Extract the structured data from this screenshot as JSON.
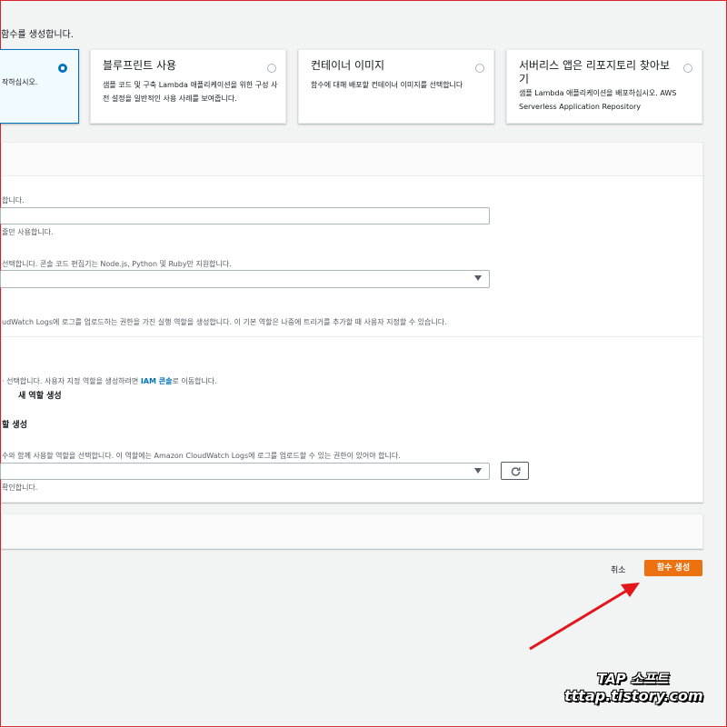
{
  "intro_text": "함수를 생성합니다.",
  "options": [
    {
      "title": "",
      "description": "작하십시오.",
      "selected": true
    },
    {
      "title": "블루프린트 사용",
      "description": "샘플 코드 및 구축 Lambda 애플리케이션을 위한 구성 사전 설정을 일반적인 사용 사례를 보여줍니다.",
      "selected": false
    },
    {
      "title": "컨테이너 이미지",
      "description": "함수에 대해 배포할 컨테이너 이미지를 선택합니다",
      "selected": false
    },
    {
      "title": "서버리스 앱은 리포지토리 찾아보기",
      "description": "샘플 Lambda 애플리케이션을 배포하십시오. AWS Serverless Application Repository",
      "selected": false
    }
  ],
  "basic_info": {
    "name_hint": "합니다.",
    "name_value": "",
    "name_constraint": "줄만 사용합니다.",
    "runtime_hint": "선택합니다. 콘솔 코드 편집기는 Node.js, Python 및 Ruby만 지원합니다.",
    "runtime_value": "",
    "permissions_text": "udWatch Logs에 로그를 업로드하는 권한을 가진 실행 역할을 생성합니다. 이 기본 역할은 나중에 트리거를 추가할 때 사용자 지정할 수 있습니다."
  },
  "execution_role": {
    "hint_prefix": "· 선택합니다. 사용자 지정 역할을 생성하려면 ",
    "hint_link": "IAM 콘솔",
    "hint_suffix": "로 이동합니다.",
    "option_new": "새 역할 생성",
    "option_policy": "할 생성",
    "existing_hint": "수와 함께 사용할 역할을 선택합니다. 이 역할에는 Amazon CloudWatch Logs에 로그를 업로드할 수 있는 권한이 있어야 합니다.",
    "existing_value": "",
    "existing_note": "확인합니다."
  },
  "footer": {
    "cancel_label": "취소",
    "create_label": "함수 생성"
  },
  "watermark": {
    "line1": "TAP 소프트",
    "line2": "tttap.tistory.com"
  },
  "colors": {
    "accent": "#0073bb",
    "primary_button": "#ec7211",
    "arrow": "#e3161b"
  },
  "icons": {
    "dropdown": "chevron-down-icon",
    "refresh": "refresh-icon"
  }
}
